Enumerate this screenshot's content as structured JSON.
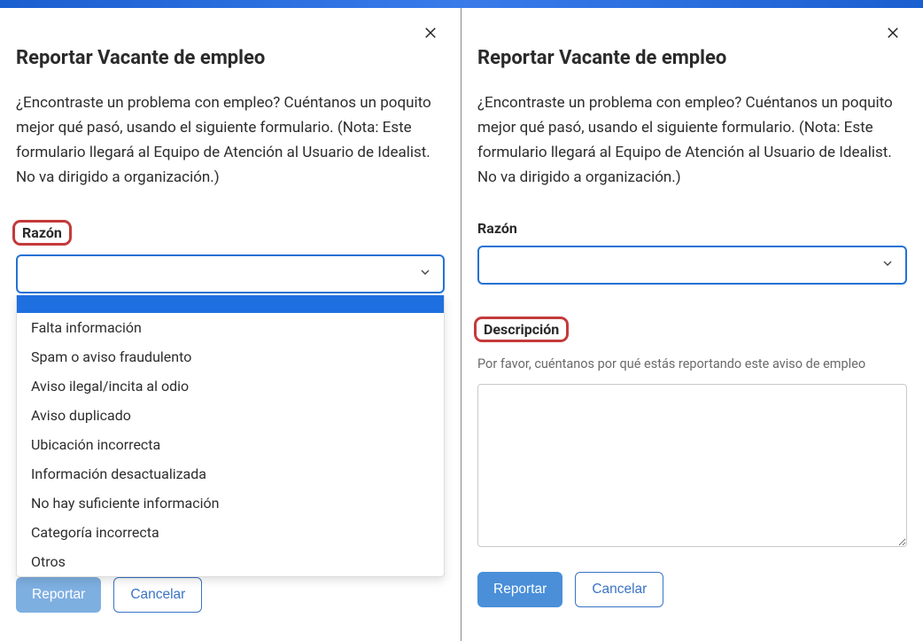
{
  "title": "Reportar Vacante de empleo",
  "intro": "¿Encontraste un problema con empleo? Cuéntanos un poquito mejor qué pasó, usando el siguiente formulario. (Nota: Este formulario llegará al Equipo de Atención al Usuario de Idealist. No va dirigido a organización.)",
  "reason": {
    "label": "Razón",
    "value": "",
    "options": [
      "Falta información",
      "Spam o aviso fraudulento",
      "Aviso ilegal/incita al odio",
      "Aviso duplicado",
      "Ubicación incorrecta",
      "Información desactualizada",
      "No hay suficiente información",
      "Categoría incorrecta",
      "Otros"
    ]
  },
  "description": {
    "label": "Descripción",
    "hint": "Por favor, cuéntanos por qué estás reportando este aviso de empleo",
    "value": ""
  },
  "buttons": {
    "report": "Reportar",
    "cancel": "Cancelar"
  }
}
